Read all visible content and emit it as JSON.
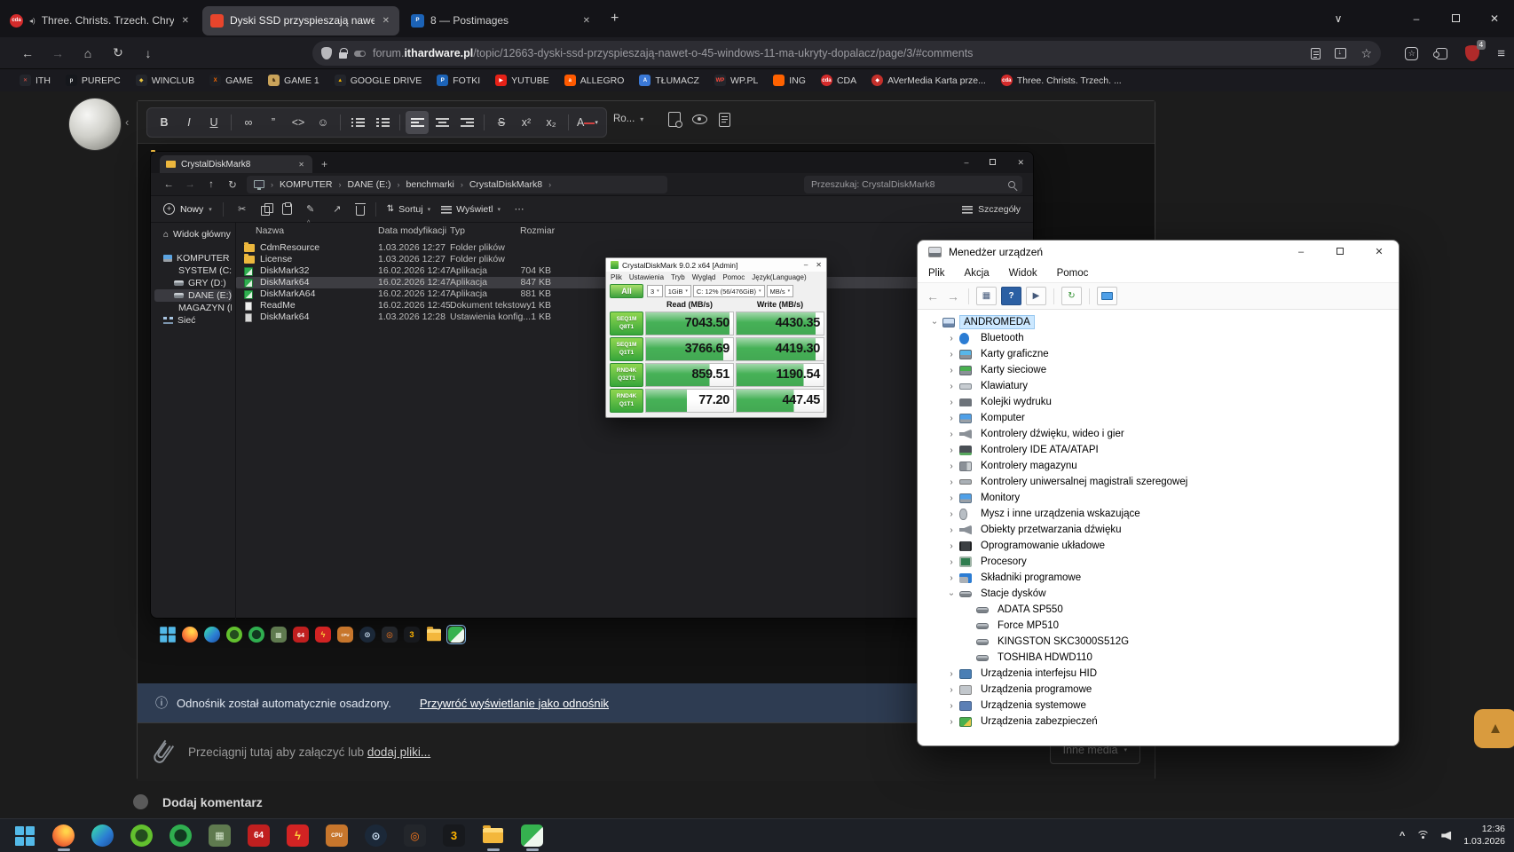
{
  "icons": {
    "back": "←",
    "forward": "→",
    "home": "⌂",
    "reload": "↻",
    "download": "↓",
    "new_tab": "+",
    "close": "✕",
    "minimize": "–",
    "chevron_down": "∨",
    "menu": "≡",
    "star": "☆",
    "up": "↑",
    "crumb_sep": "›",
    "more": "⋯",
    "sort": "⇅",
    "audio": "◂)",
    "info": "ⓘ",
    "dropdown": "▾",
    "scroll_top": "▲",
    "tray_chevron": "^",
    "cut": "✂",
    "rename": "✎",
    "share": "↗",
    "help": "?",
    "doc_play": "▶",
    "toolbar_grid": "▦",
    "scan": "↻",
    "tree_chevron": "›",
    "sort_indicator": "^"
  },
  "browser": {
    "tabs": [
      {
        "title": "Three. Christs. Trzech. Chrys",
        "fav_bg": "#d42b2b",
        "fav_g": "cda",
        "fav_round": true,
        "audio": true,
        "active": false
      },
      {
        "title": "Dyski SSD przyspieszają nawet o",
        "fav_bg": "#e8452c",
        "fav_g": "",
        "fav_round": false,
        "audio": false,
        "active": true
      },
      {
        "title": "8 — Postimages",
        "fav_bg": "#1c63b7",
        "fav_g": "P",
        "fav_round": false,
        "audio": false,
        "active": false
      }
    ],
    "url": {
      "prefix": "forum.",
      "domain": "ithardware.pl",
      "path": "/topic/12663-dyski-ssd-przyspieszają-nawet-o-45-windows-11-ma-ukryty-dopalacz/page/3/#comments"
    },
    "adblock_count": "4",
    "bookmarks": [
      {
        "label": "ITH",
        "bg": "#23252b",
        "fg": "#e05348",
        "g": "✕"
      },
      {
        "label": "PUREPC",
        "bg": "#15171c",
        "fg": "#e8e8e8",
        "g": "p"
      },
      {
        "label": "WINCLUB",
        "bg": "#23252b",
        "fg": "#e8c43f",
        "g": "◆"
      },
      {
        "label": "GAME",
        "bg": "#1d1f24",
        "fg": "#ff6a00",
        "g": "X"
      },
      {
        "label": "GAME 1",
        "bg": "#caa35a",
        "fg": "#4a3215",
        "g": "♞"
      },
      {
        "label": "GOOGLE DRIVE",
        "bg": "#23252b",
        "fg": "#f4b400",
        "g": "▲"
      },
      {
        "label": "FOTKI",
        "bg": "#1c63b7",
        "fg": "#ffffff",
        "g": "P"
      },
      {
        "label": "YUTUBE",
        "bg": "#e62117",
        "fg": "#ffffff",
        "g": "▶"
      },
      {
        "label": "ALLEGRO",
        "bg": "#ff5a00",
        "fg": "#ffffff",
        "g": "a"
      },
      {
        "label": "TŁUMACZ",
        "bg": "#3a78d6",
        "fg": "#ffffff",
        "g": "A"
      },
      {
        "label": "WP.PL",
        "bg": "#23252b",
        "fg": "#ff4a3d",
        "g": "WP"
      },
      {
        "label": "ING",
        "bg": "#ff6200",
        "fg": "#ffffff",
        "g": ""
      },
      {
        "label": "CDA",
        "bg": "#d42b2b",
        "fg": "#ffffff",
        "g": "cda",
        "round": true
      },
      {
        "label": "AVerMedia Karta prze...",
        "bg": "#c4302b",
        "fg": "#ffffff",
        "g": "◆",
        "round": true
      },
      {
        "label": "Three. Christs. Trzech. ...",
        "bg": "#d42b2b",
        "fg": "#ffffff",
        "g": "cda",
        "round": true
      }
    ]
  },
  "editor": {
    "collapse_glyph": "‹",
    "buttons": [
      {
        "n": "bold",
        "g": "B"
      },
      {
        "n": "italic",
        "g": "I"
      },
      {
        "n": "underline",
        "g": "U"
      },
      {
        "sep": true
      },
      {
        "n": "link",
        "g": "∞"
      },
      {
        "n": "quote",
        "g": "”"
      },
      {
        "n": "code",
        "g": "<>"
      },
      {
        "n": "emoji",
        "g": "☺"
      },
      {
        "sep": true
      },
      {
        "n": "bullet-list",
        "css": "ul"
      },
      {
        "n": "numbered-list",
        "css": "ol"
      },
      {
        "sep": true
      },
      {
        "n": "align-left",
        "css": "al",
        "active": true
      },
      {
        "n": "align-center",
        "css": "ac"
      },
      {
        "n": "align-right",
        "css": "ar"
      },
      {
        "sep": true
      },
      {
        "n": "strikethrough",
        "g": "S",
        "strike": true
      },
      {
        "n": "superscript",
        "g": "x²"
      },
      {
        "n": "subscript",
        "g": "x₂"
      },
      {
        "sep": true
      },
      {
        "n": "text-color",
        "g": "A",
        "dd": true
      }
    ],
    "font_dropdown": "Ro...",
    "notice_text": "Odnośnik został automatycznie osadzony.",
    "notice_link": "Przywróć wyświetlanie jako odnośnik",
    "attach_text": "Przeciągnij tutaj aby załączyć lub",
    "attach_link": "dodaj pliki...",
    "other_media_label": "Inne media",
    "comment_heading": "Dodaj komentarz"
  },
  "explorer": {
    "tab_title": "CrystalDiskMark8",
    "breadcrumbs": [
      "KOMPUTER",
      "DANE (E:)",
      "benchmarki",
      "CrystalDiskMark8"
    ],
    "search_placeholder": "Przeszukaj: CrystalDiskMark8",
    "toolbar": {
      "new_label": "Nowy",
      "sort_label": "Sortuj",
      "view_label": "Wyświetl",
      "details_label": "Szczegóły"
    },
    "columns": [
      "Nazwa",
      "Data modyfikacji",
      "Typ",
      "Rozmiar"
    ],
    "sidebar": [
      {
        "label": "Widok główny",
        "icon": "home",
        "indent": 0
      },
      {
        "label": "KOMPUTER",
        "icon": "pc",
        "indent": 0,
        "gap": true
      },
      {
        "label": "SYSTEM (C:)",
        "icon": "drive",
        "indent": 1
      },
      {
        "label": "GRY (D:)",
        "icon": "drive",
        "indent": 1
      },
      {
        "label": "DANE (E:)",
        "icon": "drive",
        "indent": 1,
        "selected": true
      },
      {
        "label": "MAGAZYN (F:)",
        "icon": "drive",
        "indent": 1
      },
      {
        "label": "Sieć",
        "icon": "net",
        "indent": 0
      }
    ],
    "files": [
      {
        "name": "CdmResource",
        "date": "1.03.2026 12:27",
        "type": "Folder plików",
        "size": "",
        "icon": "folder"
      },
      {
        "name": "License",
        "date": "1.03.2026 12:27",
        "type": "Folder plików",
        "size": "",
        "icon": "folder"
      },
      {
        "name": "DiskMark32",
        "date": "16.02.2026 12:47",
        "type": "Aplikacja",
        "size": "704 KB",
        "icon": "app"
      },
      {
        "name": "DiskMark64",
        "date": "16.02.2026 12:47",
        "type": "Aplikacja",
        "size": "847 KB",
        "icon": "app",
        "selected": true
      },
      {
        "name": "DiskMarkA64",
        "date": "16.02.2026 12:47",
        "type": "Aplikacja",
        "size": "881 KB",
        "icon": "app"
      },
      {
        "name": "ReadMe",
        "date": "16.02.2026 12:45",
        "type": "Dokument tekstowy",
        "size": "1 KB",
        "icon": "doc"
      },
      {
        "name": "DiskMark64",
        "date": "1.03.2026 12:28",
        "type": "Ustawienia konfig...",
        "size": "1 KB",
        "icon": "config"
      }
    ]
  },
  "cdm": {
    "title": "CrystalDiskMark 9.0.2 x64 [Admin]",
    "menu": [
      "Plik",
      "Ustawienia",
      "Tryb",
      "Wygląd",
      "Pomoc",
      "Język(Language)"
    ],
    "all_label": "All",
    "selectors": [
      "3",
      "1GiB",
      "C: 12% (56/476GiB)",
      "MB/s"
    ],
    "read_header": "Read (MB/s)",
    "write_header": "Write (MB/s)",
    "rows": [
      {
        "t1": "SEQ1M",
        "t2": "Q8T1",
        "read": "7043.50",
        "write": "4430.35"
      },
      {
        "t1": "SEQ1M",
        "t2": "Q1T1",
        "read": "3766.69",
        "write": "4419.30"
      },
      {
        "t1": "RND4K",
        "t2": "Q32T1",
        "read": "859.51",
        "write": "1190.54"
      },
      {
        "t1": "RND4K",
        "t2": "Q1T1",
        "read": "77.20",
        "write": "447.45"
      }
    ]
  },
  "devmgr": {
    "title": "Menedżer urządzeń",
    "menu": [
      "Plik",
      "Akcja",
      "Widok",
      "Pomoc"
    ],
    "root": "ANDROMEDA",
    "categories": [
      {
        "label": "Bluetooth",
        "icon": "bluetooth"
      },
      {
        "label": "Karty graficzne",
        "icon": "gpu"
      },
      {
        "label": "Karty sieciowe",
        "icon": "network"
      },
      {
        "label": "Klawiatury",
        "icon": "keyboard"
      },
      {
        "label": "Kolejki wydruku",
        "icon": "printer"
      },
      {
        "label": "Komputer",
        "icon": "computer"
      },
      {
        "label": "Kontrolery dźwięku, wideo i gier",
        "icon": "audio"
      },
      {
        "label": "Kontrolery IDE ATA/ATAPI",
        "icon": "ide"
      },
      {
        "label": "Kontrolery magazynu",
        "icon": "storage"
      },
      {
        "label": "Kontrolery uniwersalnej magistrali szeregowej",
        "icon": "usb"
      },
      {
        "label": "Monitory",
        "icon": "monitor"
      },
      {
        "label": "Mysz i inne urządzenia wskazujące",
        "icon": "mouse"
      },
      {
        "label": "Obiekty przetwarzania dźwięku",
        "icon": "audio"
      },
      {
        "label": "Oprogramowanie układowe",
        "icon": "firmware"
      },
      {
        "label": "Procesory",
        "icon": "cpu"
      },
      {
        "label": "Składniki programowe",
        "icon": "softcomp"
      },
      {
        "label": "Stacje dysków",
        "icon": "disk",
        "expanded": true,
        "children": [
          "ADATA SP550",
          "Force MP510",
          "KINGSTON SKC3000S512G",
          "TOSHIBA HDWD110"
        ]
      },
      {
        "label": "Urządzenia interfejsu HID",
        "icon": "hid"
      },
      {
        "label": "Urządzenia programowe",
        "icon": "softdev"
      },
      {
        "label": "Urządzenia systemowe",
        "icon": "sysdev"
      },
      {
        "label": "Urządzenia zabezpieczeń",
        "icon": "security"
      }
    ]
  },
  "taskbar": {
    "time": "12:36",
    "date": "1.03.2026",
    "icons": [
      {
        "n": "start",
        "k": "win"
      },
      {
        "n": "firefox",
        "shape": "circle",
        "bg": "radial-gradient(circle at 62% 30%,#ffd54a 8%,#ff9640 42%,#e4572e 78%)",
        "g": "",
        "fg": "#fff",
        "ind": true
      },
      {
        "n": "edge",
        "shape": "circle",
        "bg": "linear-gradient(135deg,#35c2b6 20%,#2b7cd3 60%,#1b4f9c)",
        "g": "",
        "fg": "#fff"
      },
      {
        "n": "green-player-1",
        "shape": "circle",
        "bg": "radial-gradient(circle,#234d1e 38%,#62c02e 42%)",
        "g": "",
        "fg": "#fff"
      },
      {
        "n": "green-player-2",
        "shape": "circle",
        "bg": "radial-gradient(circle,#123820 38%,#2fae4f 42%)",
        "g": "",
        "fg": "#fff"
      },
      {
        "n": "benchmark-tool",
        "shape": "square",
        "bg": "#5f7a4f",
        "g": "▦",
        "fg": "#d8e8d0"
      },
      {
        "n": "pcmark-64",
        "shape": "square",
        "bg": "#c01f1f",
        "g": "64",
        "fg": "#ffffff",
        "fs": "10"
      },
      {
        "n": "lightning-tool",
        "shape": "square",
        "bg": "#d22323",
        "g": "ϟ",
        "fg": "#ffd23e",
        "fs": "13"
      },
      {
        "n": "cpu-z",
        "shape": "square",
        "bg": "#c7762c",
        "g": "CPU",
        "fg": "#ffffff",
        "fs": "6"
      },
      {
        "n": "steam",
        "shape": "circle",
        "bg": "#1b2838",
        "g": "⊙",
        "fg": "#cfe3f5",
        "fs": "12"
      },
      {
        "n": "kombustor",
        "shape": "square",
        "bg": "#23262b",
        "g": "◎",
        "fg": "#ff7a1a",
        "fs": "12"
      },
      {
        "n": "3dmark",
        "shape": "square",
        "bg": "#17191d",
        "g": "3",
        "fg": "#ffb400",
        "fs": "13"
      },
      {
        "n": "file-explorer",
        "k": "folder",
        "ind": true
      },
      {
        "n": "crystaldiskmark",
        "shape": "square",
        "bg": "linear-gradient(135deg,#35b24f 0 55%,#eef7ee 55%)",
        "g": "",
        "fg": "#fff",
        "ind": true,
        "boxed": true
      }
    ]
  },
  "page": {
    "scroll_top_bg": "#d99b3e"
  }
}
